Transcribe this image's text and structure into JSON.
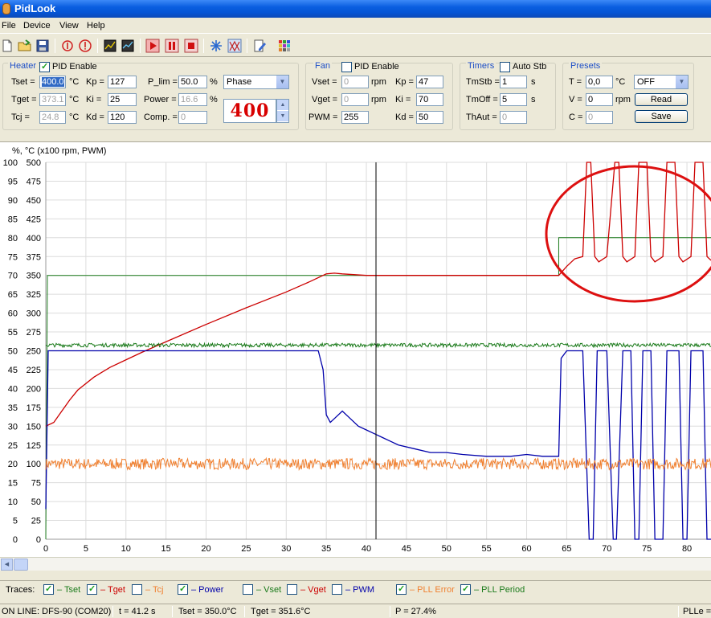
{
  "window": {
    "title": "PidLook"
  },
  "menu": [
    "File",
    "Device",
    "View",
    "Help"
  ],
  "toolbar": {
    "icons": [
      "new-file-icon",
      "open-folder-icon",
      "save-icon",
      "alert-icon",
      "alert-circle-icon",
      "chart-view-icon",
      "chart-export-icon",
      "record-icon",
      "pause-icon",
      "stop-icon",
      "snowflake-icon",
      "signal-icon",
      "edit-icon",
      "palette-icon"
    ]
  },
  "heater": {
    "title": "Heater",
    "pid_enable_label": "PID Enable",
    "pid_enabled": true,
    "tset_label": "Tset =",
    "tset_value": "400.0",
    "tset_unit": "°C",
    "tget_label": "Tget =",
    "tget_value": "373.1",
    "tget_unit": "°C",
    "tcj_label": "Tcj =",
    "tcj_value": "24.8",
    "tcj_unit": "°C",
    "kp_label": "Kp =",
    "kp_value": "127",
    "ki_label": "Ki =",
    "ki_value": "25",
    "kd_label": "Kd =",
    "kd_value": "120",
    "plim_label": "P_lim =",
    "plim_value": "50.0",
    "plim_unit": "%",
    "power_label": "Power =",
    "power_value": "16.6",
    "power_unit": "%",
    "comp_label": "Comp. =",
    "comp_value": "0",
    "mode_value": "Phase",
    "setpoint_display": "400"
  },
  "fan": {
    "title": "Fan",
    "pid_enable_label": "PID Enable",
    "pid_enabled": false,
    "vset_label": "Vset =",
    "vset_value": "0",
    "vset_unit": "rpm",
    "vget_label": "Vget =",
    "vget_value": "0",
    "vget_unit": "rpm",
    "pwm_label": "PWM =",
    "pwm_value": "255",
    "kp_label": "Kp =",
    "kp_value": "47",
    "ki_label": "Ki =",
    "ki_value": "70",
    "kd_label": "Kd =",
    "kd_value": "50"
  },
  "timers": {
    "title": "Timers",
    "autostb_label": "Auto Stb",
    "autostb_enabled": false,
    "tmstb_label": "TmStb =",
    "tmstb_value": "1",
    "tmstb_unit": "s",
    "tmoff_label": "TmOff =",
    "tmoff_value": "5",
    "tmoff_unit": "s",
    "thaut_label": "ThAut =",
    "thaut_value": "0"
  },
  "presets": {
    "title": "Presets",
    "t_label": "T =",
    "t_value": "0,0",
    "t_unit": "°C",
    "mode_value": "OFF",
    "v_label": "V =",
    "v_value": "0",
    "v_unit": "rpm",
    "c_label": "C =",
    "c_value": "0",
    "read_label": "Read",
    "save_label": "Save"
  },
  "chart_data": {
    "type": "line",
    "title": "",
    "ylabel": "%, °C (x100 rpm, PWM)",
    "xlabel": "",
    "xlim": [
      0,
      83
    ],
    "x_ticks": [
      0,
      5,
      10,
      15,
      20,
      25,
      30,
      35,
      40,
      45,
      50,
      55,
      60,
      65,
      70,
      75,
      80
    ],
    "ylim_left": [
      0,
      100
    ],
    "y_ticks_left": [
      0,
      5,
      10,
      15,
      20,
      25,
      30,
      35,
      40,
      45,
      50,
      55,
      60,
      65,
      70,
      75,
      80,
      85,
      90,
      95,
      100
    ],
    "ylim_right": [
      0,
      500
    ],
    "y_ticks_right": [
      0,
      25,
      50,
      75,
      100,
      125,
      150,
      175,
      200,
      225,
      250,
      275,
      300,
      325,
      350,
      375,
      400,
      425,
      450,
      475,
      500
    ],
    "y_ticks_left_shown": [
      "0",
      "5",
      "10",
      "15",
      "20",
      "25",
      "30",
      "35",
      "40",
      "45",
      "50",
      "55",
      "60",
      "65",
      "70",
      "75",
      "80",
      "85",
      "90",
      "95",
      "100"
    ],
    "y_ticks_right_shown": [
      "0",
      "25",
      "50",
      "75",
      "100",
      "125",
      "150",
      "175",
      "200",
      "225",
      "250",
      "275",
      "300",
      "325",
      "350",
      "375",
      "400",
      "425",
      "450",
      "475",
      "500"
    ],
    "grid": true,
    "cursor_x": 41.2,
    "series": [
      {
        "name": "Tset",
        "color": "#1a7a1a",
        "values_unit": "right",
        "points": [
          [
            0,
            0
          ],
          [
            0.2,
            350
          ],
          [
            64,
            350
          ],
          [
            64,
            400
          ],
          [
            83,
            400
          ]
        ]
      },
      {
        "name": "Tget",
        "color": "#cc0000",
        "values_unit": "right",
        "points": [
          [
            0,
            150
          ],
          [
            1,
            155
          ],
          [
            2,
            170
          ],
          [
            3,
            185
          ],
          [
            4,
            198
          ],
          [
            6,
            215
          ],
          [
            8,
            228
          ],
          [
            10,
            238
          ],
          [
            12,
            248
          ],
          [
            15,
            262
          ],
          [
            20,
            285
          ],
          [
            25,
            307
          ],
          [
            30,
            328
          ],
          [
            33,
            342
          ],
          [
            35,
            352
          ],
          [
            36,
            353
          ],
          [
            37,
            352
          ],
          [
            40,
            350
          ],
          [
            45,
            350
          ],
          [
            50,
            350
          ],
          [
            55,
            350
          ],
          [
            60,
            350
          ],
          [
            64,
            350
          ],
          [
            65,
            362
          ],
          [
            66,
            372
          ],
          [
            67,
            375
          ],
          [
            67.5,
            500
          ],
          [
            68,
            500
          ],
          [
            68.5,
            375
          ],
          [
            69,
            368
          ],
          [
            70,
            375
          ],
          [
            71,
            500
          ],
          [
            71.5,
            500
          ],
          [
            72,
            375
          ],
          [
            72.5,
            368
          ],
          [
            73.5,
            375
          ],
          [
            74,
            500
          ],
          [
            75,
            500
          ],
          [
            75.5,
            375
          ],
          [
            76,
            368
          ],
          [
            77,
            375
          ],
          [
            77.5,
            500
          ],
          [
            78.5,
            500
          ],
          [
            79,
            375
          ],
          [
            79.5,
            368
          ],
          [
            80.5,
            375
          ],
          [
            81,
            500
          ],
          [
            82,
            500
          ],
          [
            82.5,
            375
          ],
          [
            83,
            370
          ]
        ]
      },
      {
        "name": "Power",
        "color": "#0000aa",
        "values_unit": "left",
        "points": [
          [
            0,
            8
          ],
          [
            0.3,
            50
          ],
          [
            34,
            50
          ],
          [
            34.6,
            45
          ],
          [
            35,
            33
          ],
          [
            35.5,
            31
          ],
          [
            36,
            32
          ],
          [
            37,
            34
          ],
          [
            38,
            32
          ],
          [
            39,
            30
          ],
          [
            40,
            29
          ],
          [
            41,
            28
          ],
          [
            42,
            27
          ],
          [
            43,
            26
          ],
          [
            44,
            25
          ],
          [
            46,
            24
          ],
          [
            48,
            23
          ],
          [
            50,
            23
          ],
          [
            52,
            22.5
          ],
          [
            55,
            22
          ],
          [
            58,
            22
          ],
          [
            60,
            22.5
          ],
          [
            62,
            22
          ],
          [
            64,
            22
          ],
          [
            64.3,
            48
          ],
          [
            65,
            50
          ],
          [
            67,
            50
          ],
          [
            67.8,
            0
          ],
          [
            68.3,
            0
          ],
          [
            68.8,
            50
          ],
          [
            70,
            50
          ],
          [
            70.8,
            0
          ],
          [
            71.2,
            0
          ],
          [
            72,
            50
          ],
          [
            73,
            50
          ],
          [
            73.5,
            0
          ],
          [
            74,
            0
          ],
          [
            74.5,
            50
          ],
          [
            75.5,
            50
          ],
          [
            76,
            0
          ],
          [
            77,
            0
          ],
          [
            77.5,
            50
          ],
          [
            79,
            50
          ],
          [
            79.5,
            0
          ],
          [
            80,
            0
          ],
          [
            80.5,
            50
          ],
          [
            82,
            50
          ],
          [
            82.5,
            0
          ],
          [
            83,
            0
          ]
        ]
      },
      {
        "name": "PLL Error",
        "color": "#f08030",
        "values_unit": "left",
        "points": [
          [
            0,
            20
          ],
          [
            83,
            20
          ]
        ],
        "noise": 1.5
      },
      {
        "name": "PLL Period",
        "color": "#1a7a1a",
        "values_unit": "left",
        "points": [
          [
            0,
            51.5
          ],
          [
            83,
            51.5
          ]
        ],
        "noise": 0.5
      }
    ]
  },
  "traces": {
    "label": "Traces:",
    "items": [
      {
        "label": "– Tset",
        "checked": true,
        "color": "#1a7a1a"
      },
      {
        "label": "– Tget",
        "checked": true,
        "color": "#cc0000"
      },
      {
        "label": "– Tcj",
        "checked": false,
        "color": "#f08030"
      },
      {
        "label": "– Power",
        "checked": true,
        "color": "#0000aa"
      },
      {
        "label": "– Vset",
        "checked": false,
        "color": "#1a7a1a"
      },
      {
        "label": "– Vget",
        "checked": false,
        "color": "#cc0000"
      },
      {
        "label": "– PWM",
        "checked": false,
        "color": "#0000aa"
      },
      {
        "label": "– PLL Error",
        "checked": true,
        "color": "#f08030"
      },
      {
        "label": "– PLL Period",
        "checked": true,
        "color": "#1a7a1a"
      }
    ]
  },
  "status": {
    "connection": "ON LINE: DFS-90 (COM20)",
    "time": "t = 41.2 s",
    "tset": "Tset = 350.0°C",
    "tget": "Tget = 351.6°C",
    "power": "P = 27.4%",
    "plle": "PLLe ="
  }
}
